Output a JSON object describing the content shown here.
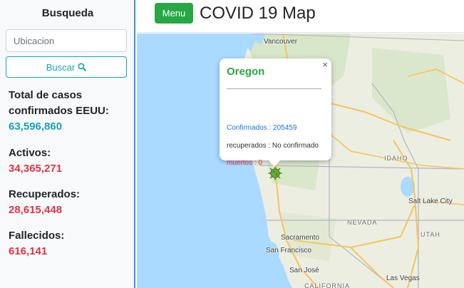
{
  "sidebar": {
    "title": "Busqueda",
    "search_placeholder": "Ubicacion",
    "search_button": "Buscar",
    "stats": {
      "total_label": "Total de casos confirmados EEUU:",
      "total_value": "63,596,860",
      "active_label": "Activos:",
      "active_value": "34,365,271",
      "recovered_label": "Recuperados:",
      "recovered_value": "28,615,448",
      "deaths_label": "Fallecidos:",
      "deaths_value": "616,141"
    }
  },
  "header": {
    "menu_button": "Menu",
    "title": "COVID 19 Map"
  },
  "map": {
    "labels": {
      "vancouver": "Vancouver",
      "idaho": "IDAHO",
      "nevada": "NEVADA",
      "utah": "UTAH",
      "california": "CALIFORNIA",
      "salt_lake": "Salt Lake City",
      "sacramento": "Sacramento",
      "san_francisco": "San Francisco",
      "san_jose": "San José",
      "las_vegas": "Las Vegas"
    },
    "popup": {
      "close": "×",
      "title": "Oregon",
      "confirmed": "Confirmados : 205459",
      "recovered": "recuperados : No confirmado",
      "deaths": "muertos : 0"
    }
  },
  "colors": {
    "accent_teal": "#17a2b8",
    "danger_red": "#dc3545",
    "success_green": "#28a745",
    "water": "#aadaff"
  }
}
